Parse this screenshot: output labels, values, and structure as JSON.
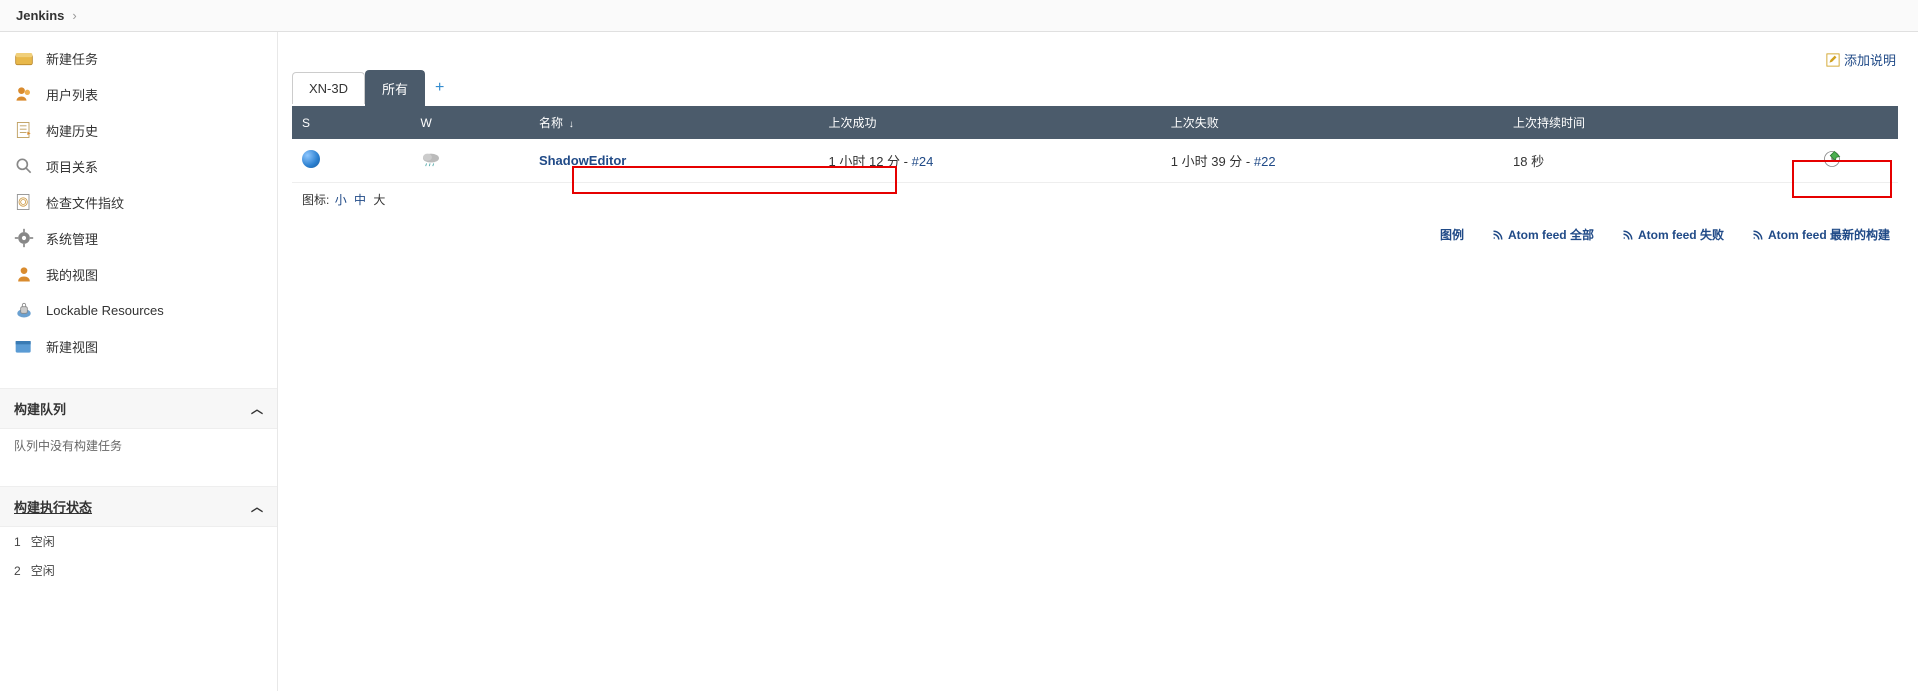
{
  "breadcrumb": {
    "root": "Jenkins"
  },
  "sidebar": {
    "items": [
      {
        "label": "新建任务",
        "icon": "new-item-icon"
      },
      {
        "label": "用户列表",
        "icon": "people-icon"
      },
      {
        "label": "构建历史",
        "icon": "history-icon"
      },
      {
        "label": "项目关系",
        "icon": "search-icon"
      },
      {
        "label": "检查文件指纹",
        "icon": "fingerprint-icon"
      },
      {
        "label": "系统管理",
        "icon": "gear-icon"
      },
      {
        "label": "我的视图",
        "icon": "my-views-icon"
      },
      {
        "label": "Lockable Resources",
        "icon": "lock-icon"
      },
      {
        "label": "新建视图",
        "icon": "new-view-icon"
      }
    ],
    "queue": {
      "title": "构建队列",
      "empty_text": "队列中没有构建任务"
    },
    "executors": {
      "title": "构建执行状态",
      "rows": [
        {
          "num": "1",
          "state": "空闲"
        },
        {
          "num": "2",
          "state": "空闲"
        }
      ]
    }
  },
  "main": {
    "add_desc_label": "添加说明",
    "tabs": [
      {
        "label": "XN-3D",
        "active": false
      },
      {
        "label": "所有",
        "active": true
      }
    ],
    "columns": {
      "s": "S",
      "w": "W",
      "name": "名称",
      "last_ok": "上次成功",
      "last_fail": "上次失败",
      "duration": "上次持续时间"
    },
    "jobs": [
      {
        "name": "ShadowEditor",
        "last_ok_text": "1 小时 12 分 - ",
        "last_ok_build": "#24",
        "last_fail_text": "1 小时 39 分 - ",
        "last_fail_build": "#22",
        "duration": "18 秒"
      }
    ],
    "icon_size": {
      "label": "图标:",
      "small": "小",
      "medium": "中",
      "large": "大"
    },
    "footer": {
      "legend": "图例",
      "feed_all": "Atom feed 全部",
      "feed_fail": "Atom feed 失败",
      "feed_latest": "Atom feed 最新的构建"
    }
  }
}
